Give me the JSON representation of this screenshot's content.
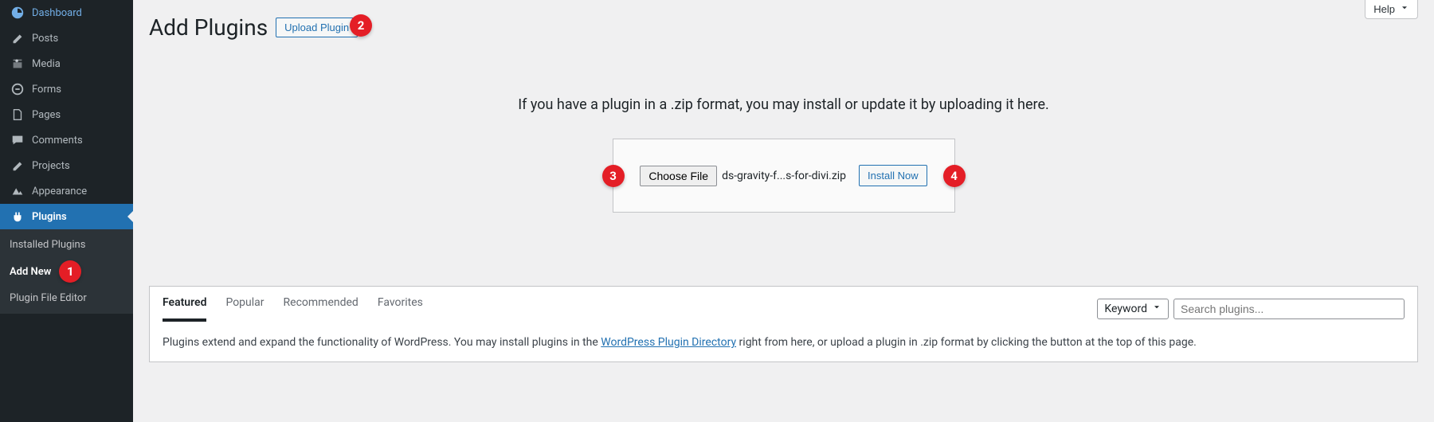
{
  "header": {
    "title": "Add Plugins",
    "upload_label": "Upload Plugin",
    "help_label": "Help"
  },
  "sidebar": {
    "items": [
      {
        "label": "Dashboard",
        "icon": "dashboard-icon"
      },
      {
        "label": "Posts",
        "icon": "posts-icon"
      },
      {
        "label": "Media",
        "icon": "media-icon"
      },
      {
        "label": "Forms",
        "icon": "forms-icon"
      },
      {
        "label": "Pages",
        "icon": "pages-icon"
      },
      {
        "label": "Comments",
        "icon": "comments-icon"
      },
      {
        "label": "Projects",
        "icon": "projects-icon"
      },
      {
        "label": "Appearance",
        "icon": "appearance-icon"
      },
      {
        "label": "Plugins",
        "icon": "plugins-icon"
      }
    ],
    "submenu": {
      "items": [
        {
          "label": "Installed Plugins"
        },
        {
          "label": "Add New"
        },
        {
          "label": "Plugin File Editor"
        }
      ]
    }
  },
  "upload": {
    "desc": "If you have a plugin in a .zip format, you may install or update it by uploading it here.",
    "choose_file_label": "Choose File",
    "filename": "ds-gravity-f...s-for-divi.zip",
    "install_label": "Install Now"
  },
  "tabs": [
    {
      "label": "Featured"
    },
    {
      "label": "Popular"
    },
    {
      "label": "Recommended"
    },
    {
      "label": "Favorites"
    }
  ],
  "search": {
    "select_label": "Keyword",
    "placeholder": "Search plugins..."
  },
  "footer": {
    "text_before": "Plugins extend and expand the functionality of WordPress. You may install plugins in the ",
    "link_text": "WordPress Plugin Directory",
    "text_after": " right from here, or upload a plugin in .zip format by clicking the button at the top of this page."
  },
  "badges": {
    "upload": "2",
    "choose_file": "3",
    "install": "4",
    "add_new": "1"
  }
}
